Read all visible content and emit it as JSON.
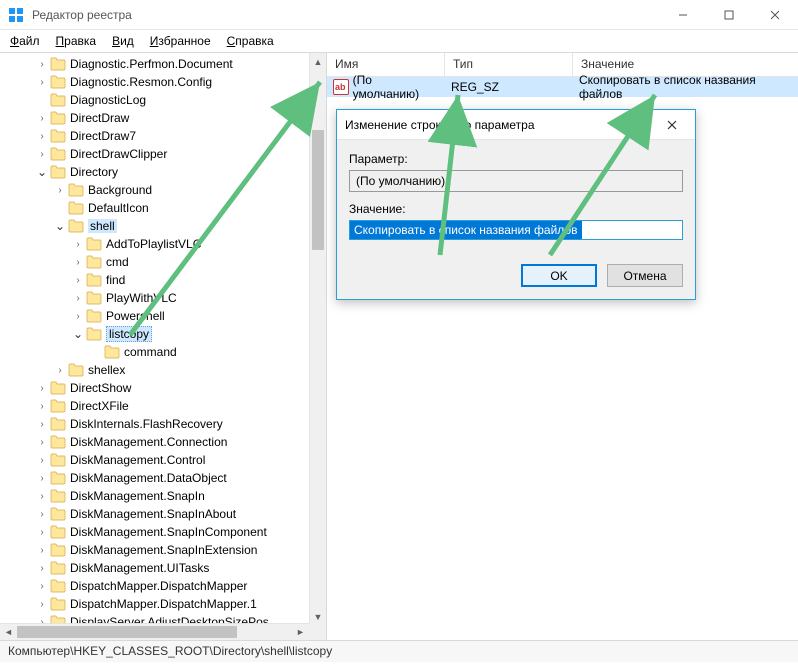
{
  "window": {
    "title": "Редактор реестра"
  },
  "menu": {
    "file": "Файл",
    "edit": "Правка",
    "view": "Вид",
    "favorites": "Избранное",
    "help": "Справка"
  },
  "tree": {
    "items": [
      {
        "depth": 2,
        "toggle": ">",
        "label": "Diagnostic.Perfmon.Document"
      },
      {
        "depth": 2,
        "toggle": ">",
        "label": "Diagnostic.Resmon.Config"
      },
      {
        "depth": 2,
        "toggle": "",
        "label": "DiagnosticLog"
      },
      {
        "depth": 2,
        "toggle": ">",
        "label": "DirectDraw"
      },
      {
        "depth": 2,
        "toggle": ">",
        "label": "DirectDraw7"
      },
      {
        "depth": 2,
        "toggle": ">",
        "label": "DirectDrawClipper"
      },
      {
        "depth": 2,
        "toggle": "v",
        "label": "Directory"
      },
      {
        "depth": 3,
        "toggle": ">",
        "label": "Background"
      },
      {
        "depth": 3,
        "toggle": "",
        "label": "DefaultIcon"
      },
      {
        "depth": 3,
        "toggle": "v",
        "label": "shell",
        "selected_parent": true
      },
      {
        "depth": 4,
        "toggle": ">",
        "label": "AddToPlaylistVLC"
      },
      {
        "depth": 4,
        "toggle": ">",
        "label": "cmd"
      },
      {
        "depth": 4,
        "toggle": ">",
        "label": "find"
      },
      {
        "depth": 4,
        "toggle": ">",
        "label": "PlayWithVLC"
      },
      {
        "depth": 4,
        "toggle": ">",
        "label": "Powershell"
      },
      {
        "depth": 4,
        "toggle": "v",
        "label": "listcopy",
        "selected": true
      },
      {
        "depth": 5,
        "toggle": "",
        "label": "command"
      },
      {
        "depth": 3,
        "toggle": ">",
        "label": "shellex"
      },
      {
        "depth": 2,
        "toggle": ">",
        "label": "DirectShow"
      },
      {
        "depth": 2,
        "toggle": ">",
        "label": "DirectXFile"
      },
      {
        "depth": 2,
        "toggle": ">",
        "label": "DiskInternals.FlashRecovery"
      },
      {
        "depth": 2,
        "toggle": ">",
        "label": "DiskManagement.Connection"
      },
      {
        "depth": 2,
        "toggle": ">",
        "label": "DiskManagement.Control"
      },
      {
        "depth": 2,
        "toggle": ">",
        "label": "DiskManagement.DataObject"
      },
      {
        "depth": 2,
        "toggle": ">",
        "label": "DiskManagement.SnapIn"
      },
      {
        "depth": 2,
        "toggle": ">",
        "label": "DiskManagement.SnapInAbout"
      },
      {
        "depth": 2,
        "toggle": ">",
        "label": "DiskManagement.SnapInComponent"
      },
      {
        "depth": 2,
        "toggle": ">",
        "label": "DiskManagement.SnapInExtension"
      },
      {
        "depth": 2,
        "toggle": ">",
        "label": "DiskManagement.UITasks"
      },
      {
        "depth": 2,
        "toggle": ">",
        "label": "DispatchMapper.DispatchMapper"
      },
      {
        "depth": 2,
        "toggle": ">",
        "label": "DispatchMapper.DispatchMapper.1"
      },
      {
        "depth": 2,
        "toggle": ">",
        "label": "DisplayServer.AdjustDesktopSizePos"
      }
    ]
  },
  "list": {
    "headers": {
      "name": "Имя",
      "type": "Тип",
      "value": "Значение"
    },
    "rows": [
      {
        "name": "(По умолчанию)",
        "type": "REG_SZ",
        "value": "Скопировать в список названия файлов"
      }
    ]
  },
  "dialog": {
    "title": "Изменение строкового параметра",
    "param_label": "Параметр:",
    "param_value": "(По умолчанию)",
    "value_label": "Значение:",
    "value_value": "Скопировать в список названия файлов",
    "ok": "OK",
    "cancel": "Отмена"
  },
  "statusbar": {
    "path": "Компьютер\\HKEY_CLASSES_ROOT\\Directory\\shell\\listcopy"
  }
}
